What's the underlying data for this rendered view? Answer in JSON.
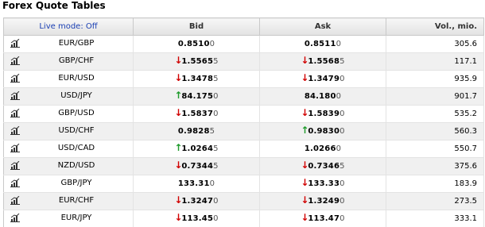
{
  "title": "Forex Quote Tables",
  "header": {
    "live_mode": "Live mode: Off",
    "bid": "Bid",
    "ask": "Ask",
    "vol": "Vol., mio."
  },
  "colors": {
    "up": "#1d9a2a",
    "down": "#d10000",
    "live_link": "#1a3fb3"
  },
  "rows": [
    {
      "pair": "EUR/GBP",
      "bid_dir": "",
      "bid_main": "0.8510",
      "bid_pip": "0",
      "ask_dir": "",
      "ask_main": "0.8511",
      "ask_pip": "0",
      "vol": "305.6"
    },
    {
      "pair": "GBP/CHF",
      "bid_dir": "down",
      "bid_main": "1.5565",
      "bid_pip": "5",
      "ask_dir": "down",
      "ask_main": "1.5568",
      "ask_pip": "5",
      "vol": "117.1"
    },
    {
      "pair": "EUR/USD",
      "bid_dir": "down",
      "bid_main": "1.3478",
      "bid_pip": "5",
      "ask_dir": "down",
      "ask_main": "1.3479",
      "ask_pip": "0",
      "vol": "935.9"
    },
    {
      "pair": "USD/JPY",
      "bid_dir": "up",
      "bid_main": "84.175",
      "bid_pip": "0",
      "ask_dir": "",
      "ask_main": "84.180",
      "ask_pip": "0",
      "vol": "901.7"
    },
    {
      "pair": "GBP/USD",
      "bid_dir": "down",
      "bid_main": "1.5837",
      "bid_pip": "0",
      "ask_dir": "down",
      "ask_main": "1.5839",
      "ask_pip": "0",
      "vol": "535.2"
    },
    {
      "pair": "USD/CHF",
      "bid_dir": "",
      "bid_main": "0.9828",
      "bid_pip": "5",
      "ask_dir": "up",
      "ask_main": "0.9830",
      "ask_pip": "0",
      "vol": "560.3"
    },
    {
      "pair": "USD/CAD",
      "bid_dir": "up",
      "bid_main": "1.0264",
      "bid_pip": "5",
      "ask_dir": "",
      "ask_main": "1.0266",
      "ask_pip": "0",
      "vol": "550.7"
    },
    {
      "pair": "NZD/USD",
      "bid_dir": "down",
      "bid_main": "0.7344",
      "bid_pip": "5",
      "ask_dir": "down",
      "ask_main": "0.7346",
      "ask_pip": "5",
      "vol": "375.6"
    },
    {
      "pair": "GBP/JPY",
      "bid_dir": "",
      "bid_main": "133.31",
      "bid_pip": "0",
      "ask_dir": "down",
      "ask_main": "133.33",
      "ask_pip": "0",
      "vol": "183.9"
    },
    {
      "pair": "EUR/CHF",
      "bid_dir": "down",
      "bid_main": "1.3247",
      "bid_pip": "0",
      "ask_dir": "down",
      "ask_main": "1.3249",
      "ask_pip": "0",
      "vol": "273.5"
    },
    {
      "pair": "EUR/JPY",
      "bid_dir": "down",
      "bid_main": "113.45",
      "bid_pip": "0",
      "ask_dir": "down",
      "ask_main": "113.47",
      "ask_pip": "0",
      "vol": "333.1"
    }
  ]
}
